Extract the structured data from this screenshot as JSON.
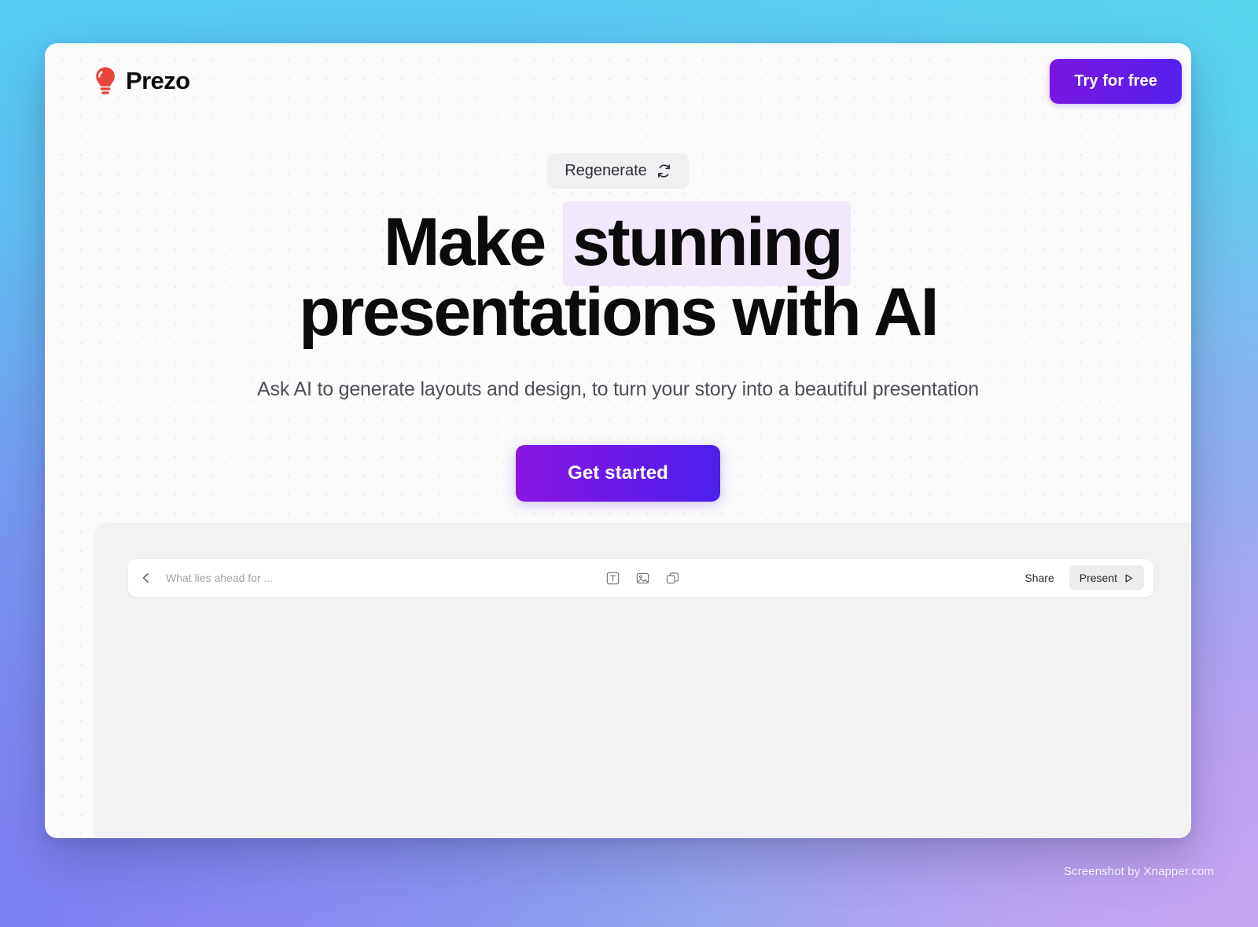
{
  "background": {
    "top_left_color": "#55ccf5",
    "bottom_left_color": "#7b7ff0",
    "bottom_right_color": "#bfa4f3"
  },
  "header": {
    "brand_name": "Prezo",
    "brand_icon": "lightbulb-icon",
    "brand_icon_color": "#e8453c",
    "try_button_label": "Try for free",
    "try_button_gradient_from": "#7b16e0",
    "try_button_gradient_to": "#5322ee"
  },
  "hero": {
    "regenerate_label": "Regenerate",
    "regenerate_icon": "refresh-icon",
    "headline_part1": "Make",
    "headline_highlight": "stunning",
    "headline_part2": "presentations with AI",
    "highlight_color": "#f2e8fc",
    "subtitle": "Ask AI to generate layouts and design, to turn your story into a beautiful presentation",
    "cta_label": "Get started",
    "cta_gradient_from": "#8a16e3",
    "cta_gradient_to": "#4a20ee"
  },
  "editor": {
    "back_icon": "chevron-left-icon",
    "document_title": "What lies ahead for ...",
    "tools": [
      {
        "name": "text-box-icon",
        "label": "Text"
      },
      {
        "name": "image-icon",
        "label": "Image"
      },
      {
        "name": "shape-icon",
        "label": "Shape"
      }
    ],
    "share_label": "Share",
    "present_label": "Present",
    "present_icon": "play-icon"
  },
  "watermark": {
    "text": "Screenshot by Xnapper.com"
  }
}
